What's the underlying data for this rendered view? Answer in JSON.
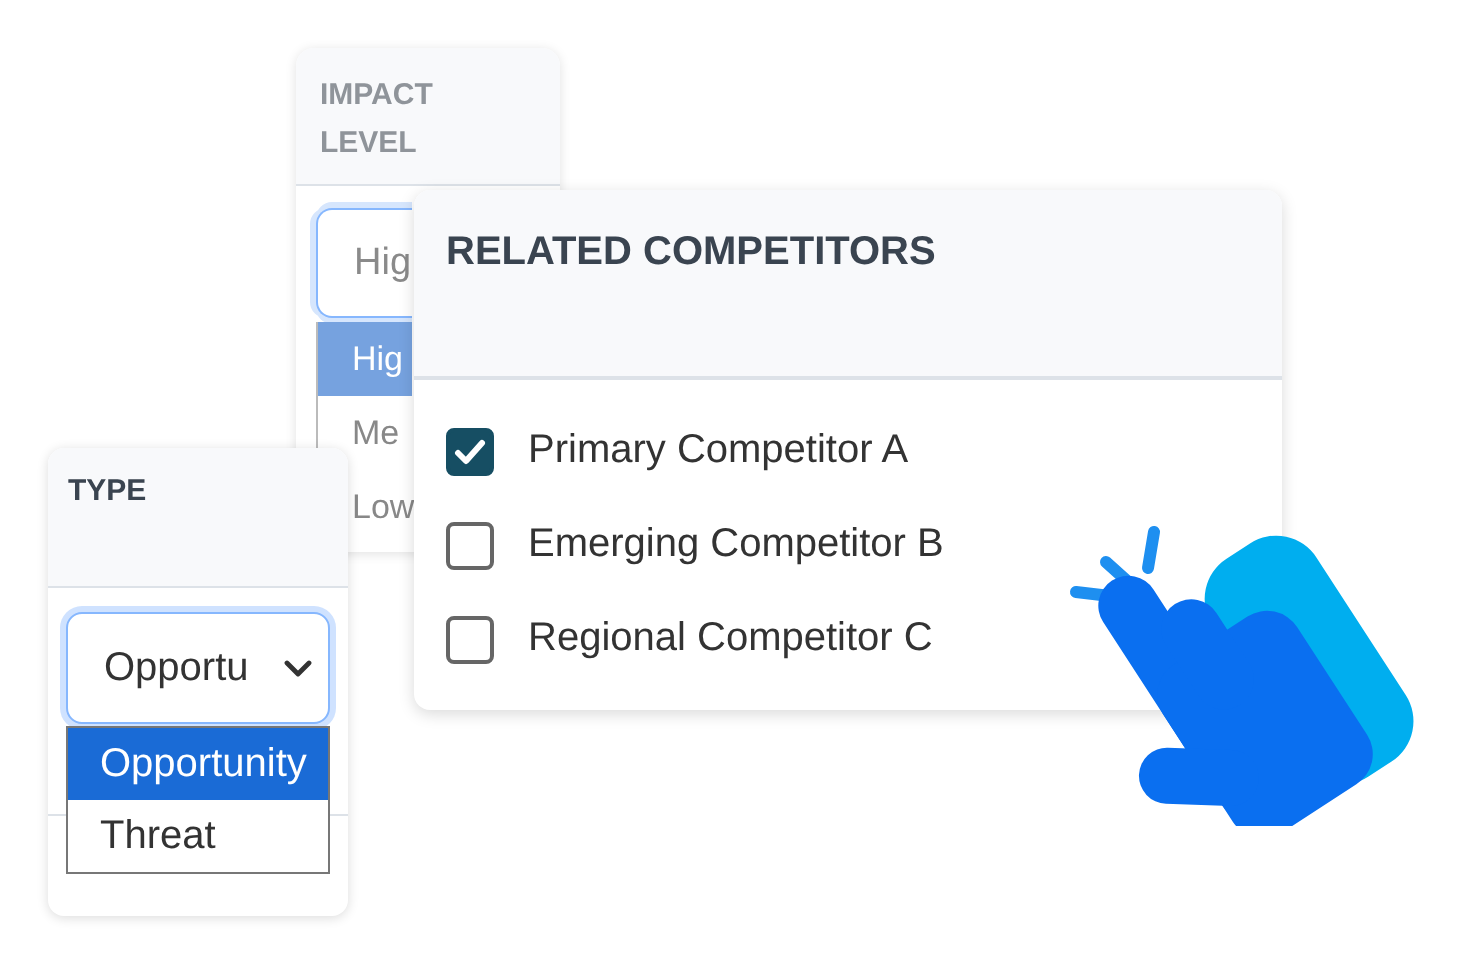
{
  "impact_card": {
    "header": "IMPACT LEVEL",
    "select": {
      "value": "Hig"
    },
    "options": [
      {
        "label": "Hig",
        "selected": true
      },
      {
        "label": "Me",
        "selected": false
      },
      {
        "label": "Low",
        "selected": false
      }
    ]
  },
  "type_card": {
    "header": "TYPE",
    "select": {
      "value": "Opportu"
    },
    "options": [
      {
        "label": "Opportunity",
        "selected": true
      },
      {
        "label": "Threat",
        "selected": false
      }
    ]
  },
  "competitors_card": {
    "title": "RELATED COMPETITORS",
    "items": [
      {
        "label": "Primary Competitor A",
        "checked": true
      },
      {
        "label": "Emerging Competitor B",
        "checked": false
      },
      {
        "label": "Regional Competitor C",
        "checked": false
      }
    ]
  }
}
